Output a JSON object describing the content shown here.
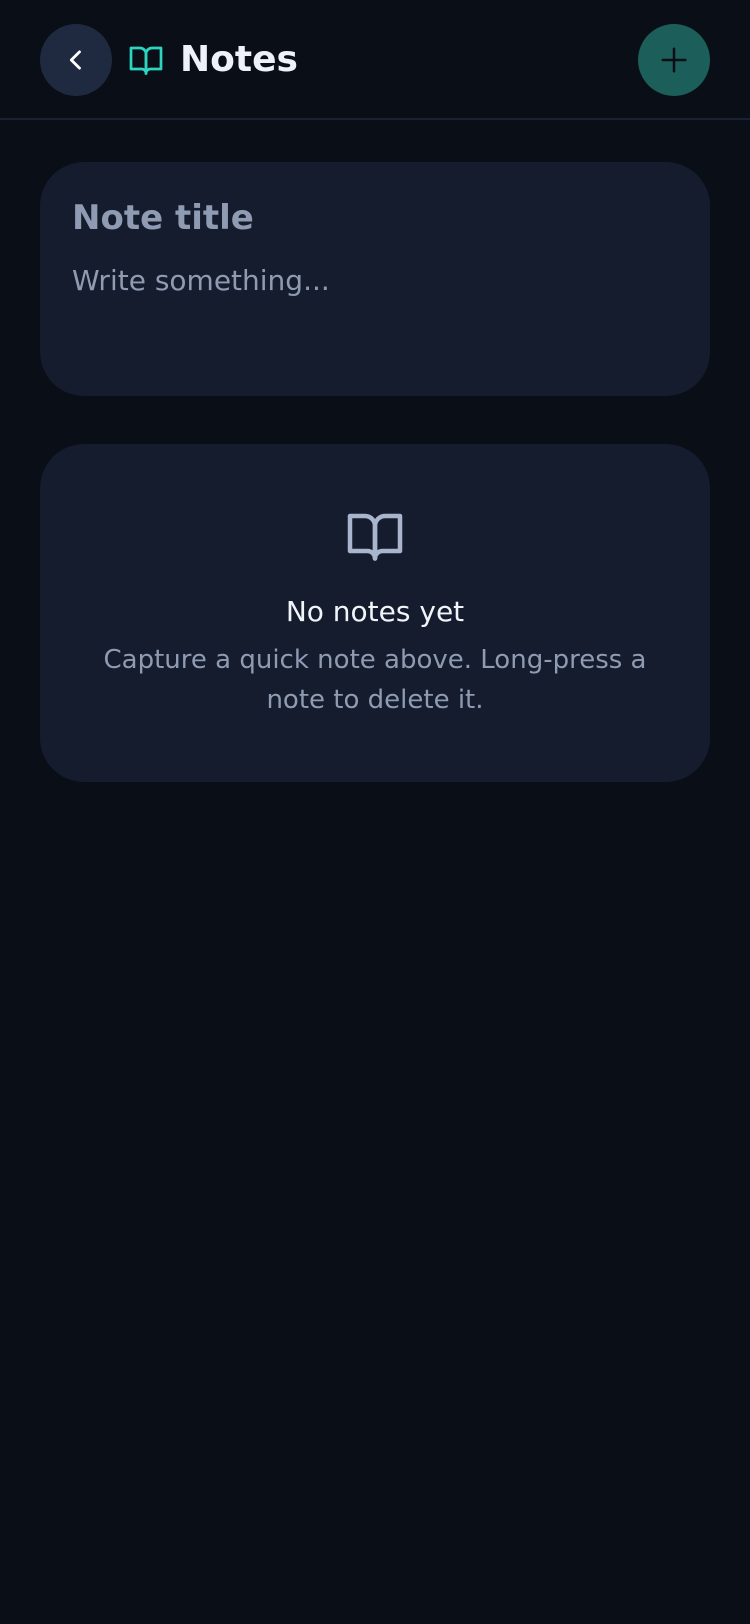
{
  "header": {
    "back_icon": "chevron-left-icon",
    "title_icon": "book-open-icon",
    "title": "Notes",
    "add_icon": "plus-icon"
  },
  "composer": {
    "title_placeholder": "Note title",
    "title_value": "",
    "body_placeholder": "Write something...",
    "body_value": ""
  },
  "empty_state": {
    "icon": "book-open-icon",
    "title": "No notes yet",
    "subtitle": "Capture a quick note above. Long-press a note to delete it."
  },
  "colors": {
    "background": "#0a0e17",
    "card": "#141c2d",
    "accent": "#2dd4bf",
    "add_button": "#1c5e5a",
    "back_button": "#1f2a40"
  }
}
